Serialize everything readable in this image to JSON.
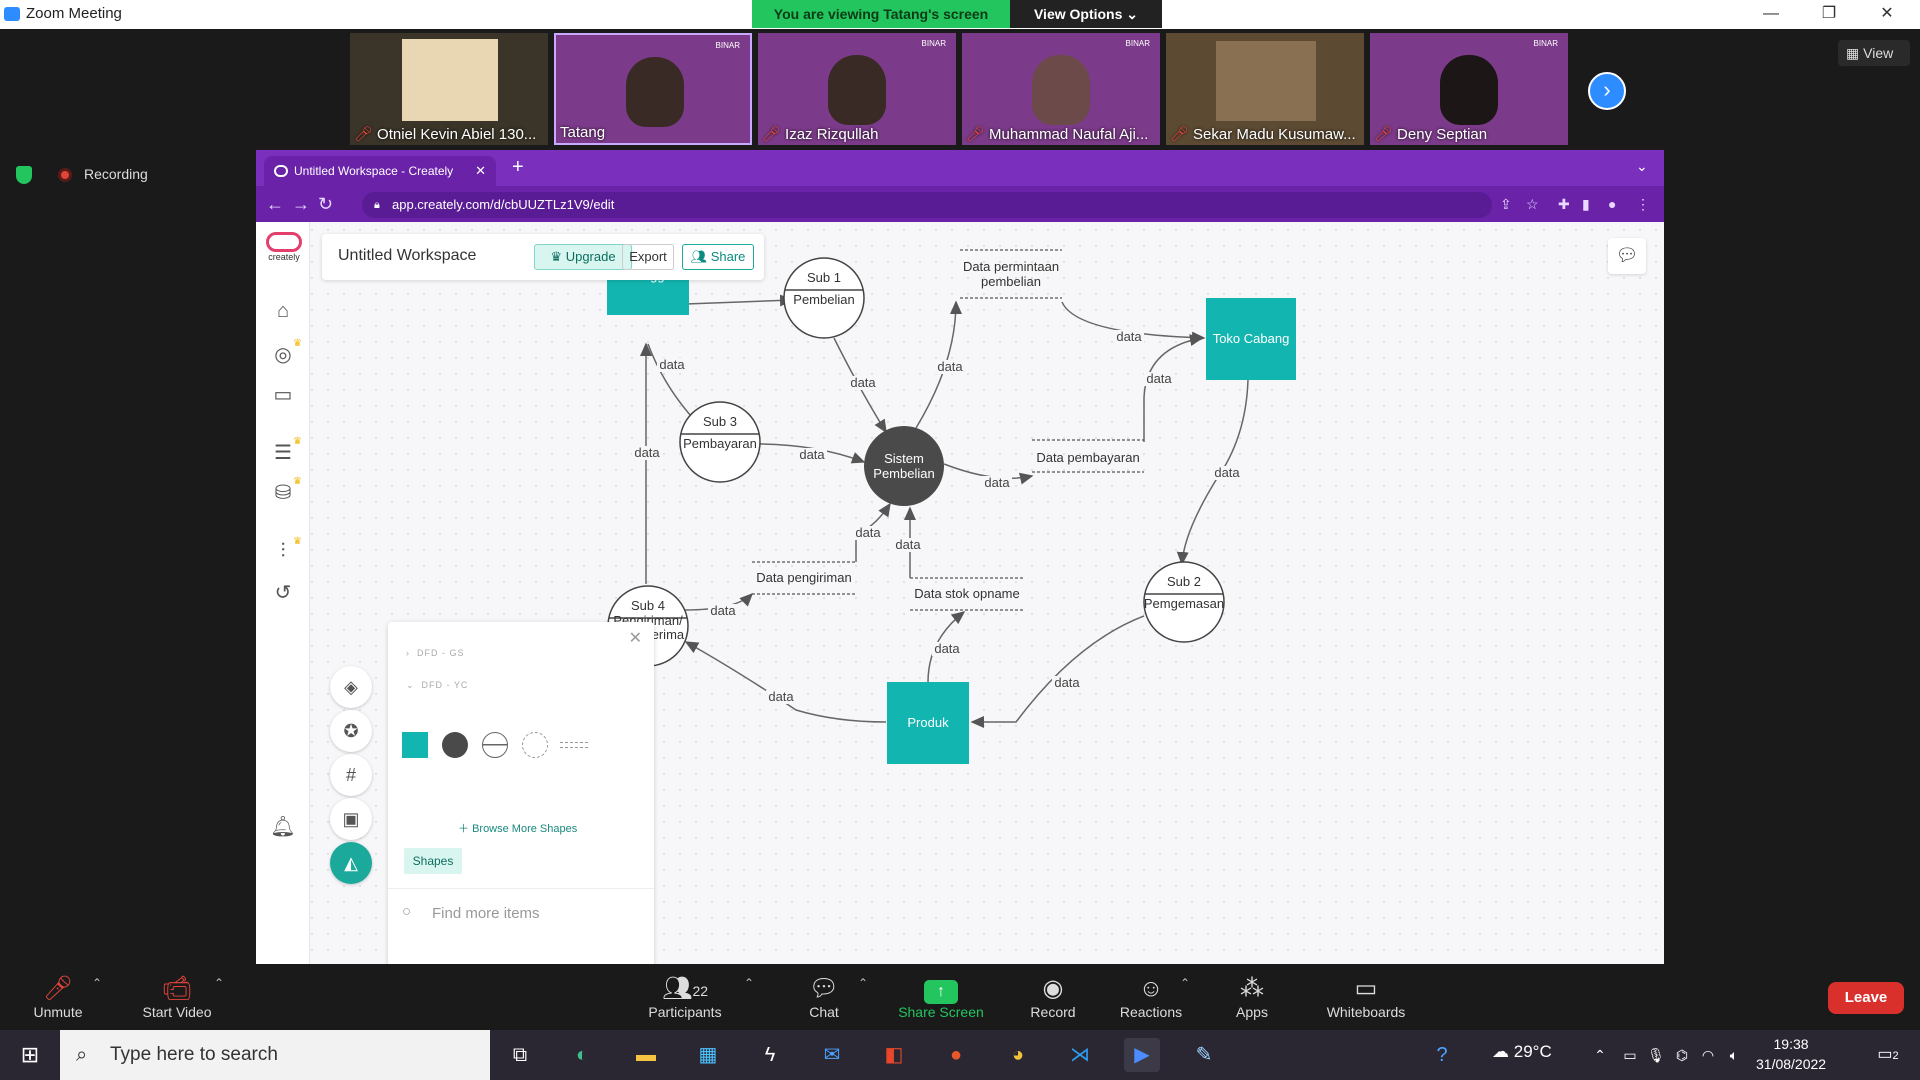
{
  "window": {
    "title": "Zoom Meeting",
    "minimize": "—",
    "restore": "❐",
    "close": "✕"
  },
  "banner": {
    "viewing": "You are viewing Tatang's screen",
    "view_options": "View Options ⌄"
  },
  "participants_strip": [
    {
      "name": "Otniel Kevin Abiel 130...",
      "muted": true
    },
    {
      "name": "Tatang",
      "muted": false
    },
    {
      "name": "Izaz Rizqullah",
      "muted": true
    },
    {
      "name": "Muhammad Naufal Aji...",
      "muted": true
    },
    {
      "name": "Sekar Madu Kusumaw...",
      "muted": true
    },
    {
      "name": "Deny Septian",
      "muted": true
    }
  ],
  "thumb_brand": "BINAR",
  "view_button": "View",
  "recording_label": "Recording",
  "browser": {
    "tab_title": "Untitled Workspace - Creately",
    "url": "app.creately.com/d/cbUUZTLz1V9/edit"
  },
  "creately": {
    "logo_text": "creately",
    "workspace_title": "Untitled Workspace",
    "upgrade": "Upgrade",
    "export": "Export",
    "share": "Share",
    "panel": {
      "group1": "DFD - GS",
      "group2": "DFD - YC",
      "browse": "Browse More Shapes",
      "tab": "Shapes",
      "find_placeholder": "Find more items"
    }
  },
  "diagram": {
    "entities": [
      "Pelanggan",
      "Toko Cabang",
      "Produk"
    ],
    "center": [
      "Sistem",
      "Pembelian"
    ],
    "processes": [
      {
        "id": "Sub 1",
        "name": "Pembelian"
      },
      {
        "id": "Sub 3",
        "name": "Pembayaran"
      },
      {
        "id": "Sub 2",
        "name": "Pemgemasan"
      },
      {
        "id": "Sub 4",
        "name": "Pengiriman/",
        "name2": "serah terima"
      }
    ],
    "stores": [
      "Data permintaan",
      "pembelian",
      "Data pembayaran",
      "Data pengiriman",
      "Data stok opname"
    ],
    "flow_label": "data"
  },
  "controls": {
    "unmute": "Unmute",
    "start_video": "Start Video",
    "participants": "Participants",
    "participants_count": "22",
    "chat": "Chat",
    "share_screen": "Share Screen",
    "record": "Record",
    "reactions": "Reactions",
    "apps": "Apps",
    "whiteboards": "Whiteboards",
    "leave": "Leave"
  },
  "taskbar": {
    "search_placeholder": "Type here to search",
    "temperature": "29°C",
    "time": "19:38",
    "date": "31/08/2022",
    "notifications": "2"
  },
  "colors": {
    "teal": "#12b5b0",
    "purple": "#7b2fbd",
    "green": "#23c55e",
    "leave": "#d9302c"
  }
}
